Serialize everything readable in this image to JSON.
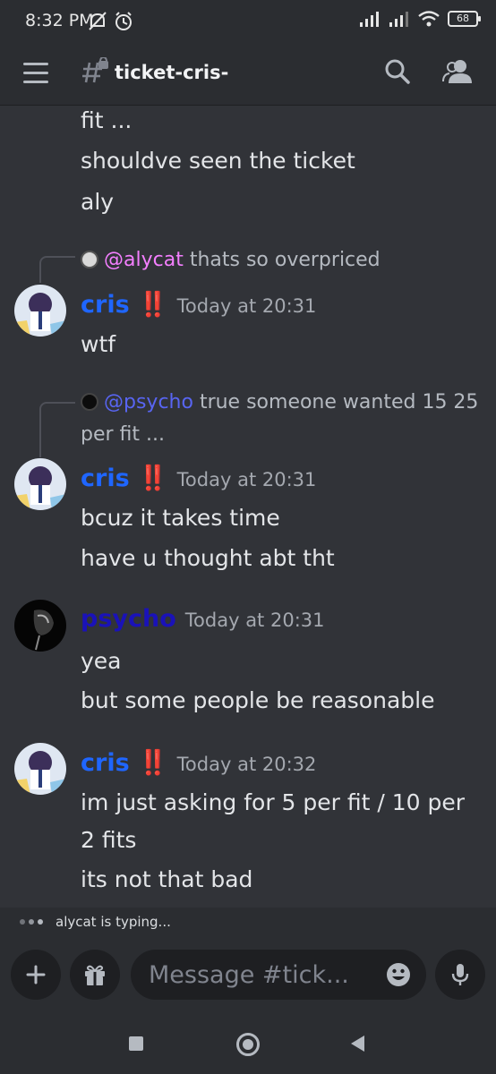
{
  "status_bar": {
    "time": "8:32 PM",
    "battery": "68"
  },
  "header": {
    "channel_name": "ticket-cris-"
  },
  "messages": {
    "cont_lines": [
      "fit ...",
      "shouldve seen the ticket",
      "aly"
    ],
    "reply1": {
      "mention": "@alycat",
      "text": " thats so overpriced"
    },
    "group1": {
      "author": "cris ‼️",
      "time": "Today at 20:31",
      "lines": [
        "wtf"
      ]
    },
    "reply2": {
      "mention": "@psycho",
      "text": " true someone wanted 15 25",
      "text2": "per fit ..."
    },
    "group2": {
      "author": "cris ‼️",
      "time": "Today at 20:31",
      "lines": [
        "bcuz it takes time",
        "have u thought abt tht"
      ]
    },
    "group3": {
      "author": "psycho",
      "time": "Today at 20:31",
      "lines": [
        "yea",
        "but some people be reasonable"
      ]
    },
    "group4": {
      "author": "cris ‼️",
      "time": "Today at 20:32",
      "lines": [
        "im just asking for 5 per fit / 10 per",
        "2 fits",
        "its not that bad"
      ]
    }
  },
  "typing": {
    "text": "alycat is typing..."
  },
  "composer": {
    "placeholder": "Message #tick..."
  },
  "colors": {
    "background": "#313338",
    "cris_name": "#1f66ff",
    "psycho_name": "#1a12b8",
    "mention_pink": "#f47fff",
    "mention_blue": "#5865f2"
  }
}
